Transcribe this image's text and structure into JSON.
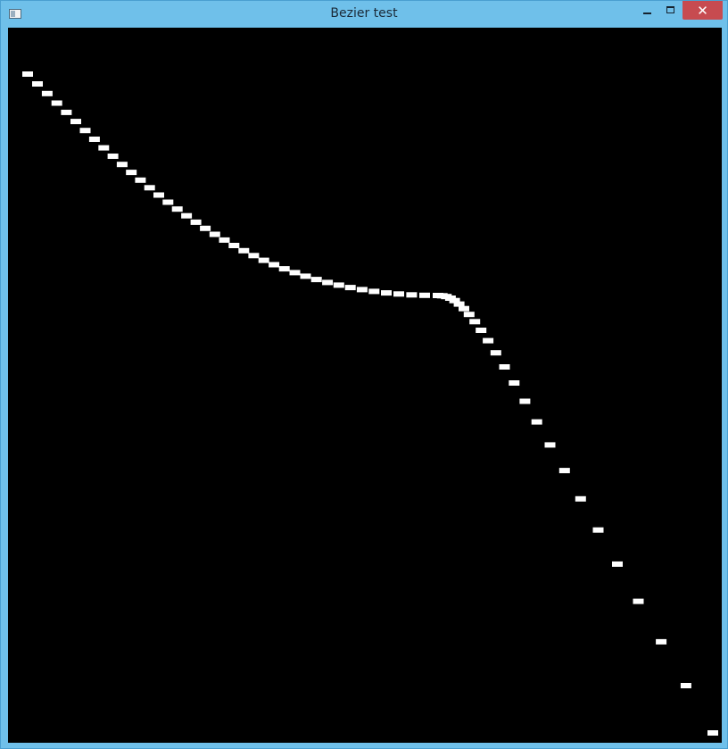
{
  "window": {
    "title": "Bezier test",
    "close_glyph": "✕"
  },
  "icons": {
    "app": "app-window-icon",
    "minimize": "minimize-icon",
    "maximize": "maximize-icon",
    "close": "close-icon"
  },
  "colors": {
    "titlebar": "#6fc0ea",
    "close_button": "#c74b50",
    "canvas_background": "#000000",
    "curve_markers": "#ffffff"
  }
}
